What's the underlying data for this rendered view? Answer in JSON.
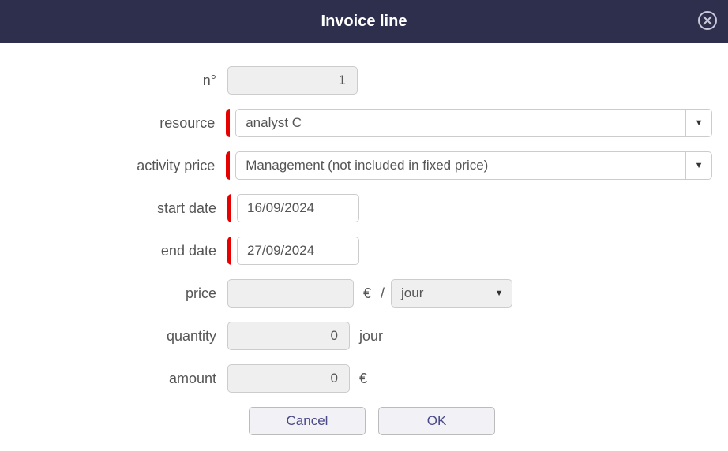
{
  "dialog": {
    "title": "Invoice line"
  },
  "fields": {
    "number": {
      "label": "n°",
      "value": "1"
    },
    "resource": {
      "label": "resource",
      "value": "analyst C"
    },
    "activity_price": {
      "label": "activity price",
      "value": "Management (not included in fixed price)"
    },
    "start_date": {
      "label": "start date",
      "value": "16/09/2024"
    },
    "end_date": {
      "label": "end date",
      "value": "27/09/2024"
    },
    "price": {
      "label": "price",
      "value": "",
      "currency": "€",
      "separator": "/",
      "unit": "jour"
    },
    "quantity": {
      "label": "quantity",
      "value": "0",
      "unit": "jour"
    },
    "amount": {
      "label": "amount",
      "value": "0",
      "currency": "€"
    }
  },
  "buttons": {
    "cancel": "Cancel",
    "ok": "OK"
  }
}
